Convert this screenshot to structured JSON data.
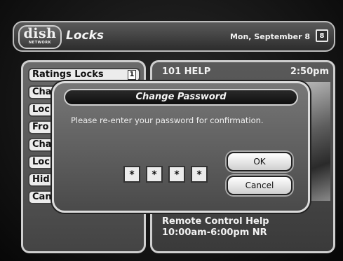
{
  "header": {
    "logo_main": "dish",
    "logo_sub": "NETWORK",
    "title": "Locks",
    "date": "Mon, September 8",
    "calendar_icon_label": "8"
  },
  "menu": {
    "items": [
      {
        "label": "Ratings Locks",
        "number": "1"
      },
      {
        "label": "Cha"
      },
      {
        "label": "Loc"
      },
      {
        "label": "Fro"
      },
      {
        "label": "Cha"
      },
      {
        "label": "Loc"
      },
      {
        "label": "Hid"
      },
      {
        "label": "Can"
      }
    ]
  },
  "info": {
    "channel": "101 HELP",
    "time": "2:50pm",
    "program_title": "Remote Control Help",
    "program_time": "10:00am-6:00pm NR"
  },
  "dialog": {
    "title": "Change Password",
    "message": "Please re-enter your password for confirmation.",
    "password_chars": [
      "*",
      "*",
      "*",
      "*"
    ],
    "ok_label": "OK",
    "cancel_label": "Cancel"
  },
  "icons": {
    "calendar": "calendar-icon"
  }
}
